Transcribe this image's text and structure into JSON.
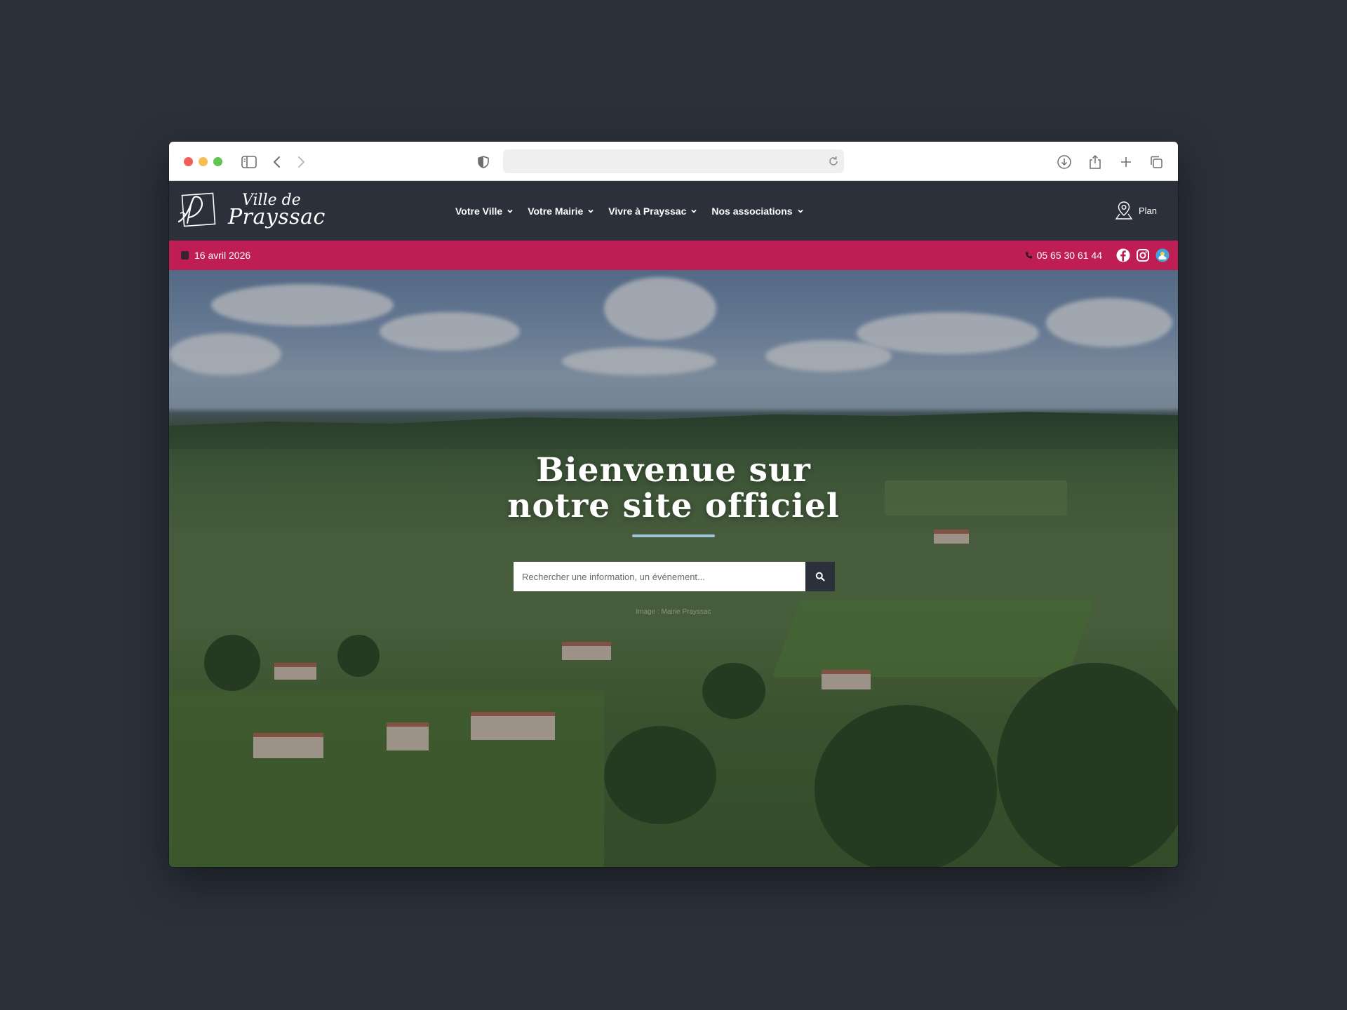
{
  "site": {
    "logo": {
      "line1": "Ville de",
      "line2": "Prayssac"
    },
    "nav": [
      {
        "label": "Votre Ville"
      },
      {
        "label": "Votre Mairie"
      },
      {
        "label": "Vivre à Prayssac"
      },
      {
        "label": "Nos associations"
      }
    ],
    "plan_label": "Plan"
  },
  "info_bar": {
    "date": "16 avril 2026",
    "phone": "05 65 30 61 44",
    "socials": [
      "facebook-icon",
      "instagram-icon",
      "weather-icon"
    ]
  },
  "hero": {
    "title_line1": "Bienvenue sur",
    "title_line2": "notre site officiel",
    "search_placeholder": "Rechercher une information, un événement...",
    "credit": "Image : Mairie Prayssac"
  },
  "colors": {
    "header": "#2b303a",
    "accent": "#be1e53",
    "rule": "#9cc3d8"
  }
}
